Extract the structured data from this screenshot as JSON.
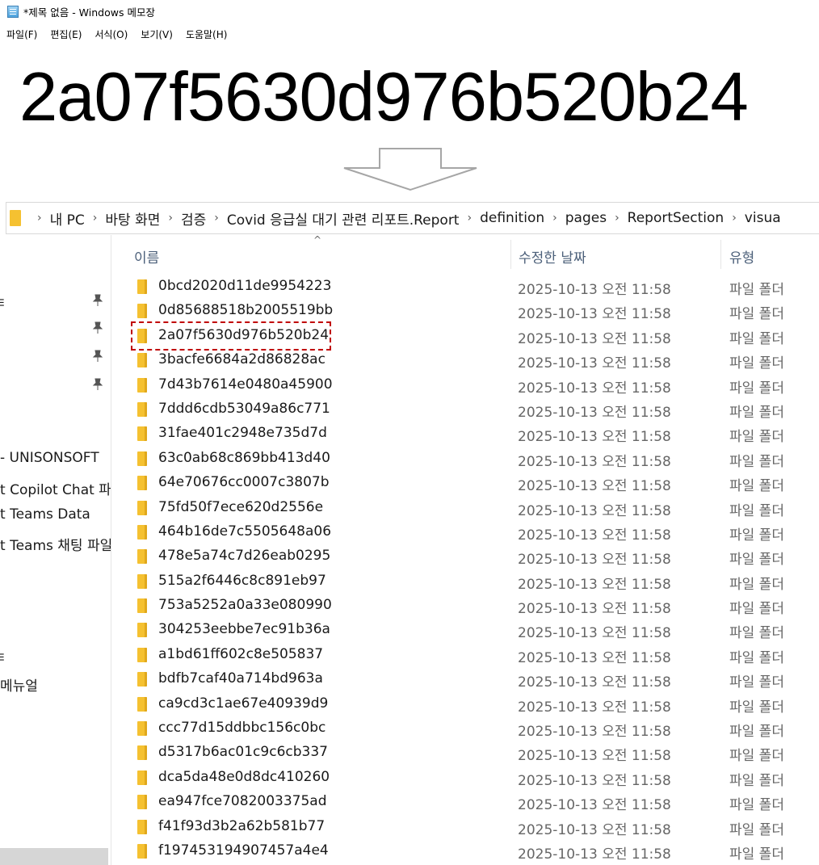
{
  "notepad": {
    "title": "*제목 없음 - Windows 메모장",
    "menu": [
      "파일(F)",
      "편집(E)",
      "서식(O)",
      "보기(V)",
      "도움말(H)"
    ],
    "content": "2a07f5630d976b520b24"
  },
  "explorer": {
    "breadcrumb": [
      "내 PC",
      "바탕 화면",
      "검증",
      "Covid 응급실 대기 관련 리포트.Report",
      "definition",
      "pages",
      "ReportSection",
      "visua"
    ],
    "nav": [
      {
        "label": "ㅌ"
      },
      {
        "label": "- UNISONSOFT"
      },
      {
        "label": "t Copilot Chat 파'"
      },
      {
        "label": "t Teams Data"
      },
      {
        "label": "t Teams 채팅 파일"
      },
      {
        "label": "ㅌ"
      },
      {
        "label": " 메뉴얼"
      }
    ],
    "columns": {
      "name": "이름",
      "date": "수정한 날짜",
      "type": "유형"
    },
    "rows": [
      {
        "name": "0bcd2020d11de9954223",
        "date": "2025-10-13 오전 11:58",
        "type": "파일 폴더"
      },
      {
        "name": "0d85688518b2005519bb",
        "date": "2025-10-13 오전 11:58",
        "type": "파일 폴더"
      },
      {
        "name": "2a07f5630d976b520b24",
        "date": "2025-10-13 오전 11:58",
        "type": "파일 폴더"
      },
      {
        "name": "3bacfe6684a2d86828ac",
        "date": "2025-10-13 오전 11:58",
        "type": "파일 폴더"
      },
      {
        "name": "7d43b7614e0480a45900",
        "date": "2025-10-13 오전 11:58",
        "type": "파일 폴더"
      },
      {
        "name": "7ddd6cdb53049a86c771",
        "date": "2025-10-13 오전 11:58",
        "type": "파일 폴더"
      },
      {
        "name": "31fae401c2948e735d7d",
        "date": "2025-10-13 오전 11:58",
        "type": "파일 폴더"
      },
      {
        "name": "63c0ab68c869bb413d40",
        "date": "2025-10-13 오전 11:58",
        "type": "파일 폴더"
      },
      {
        "name": "64e70676cc0007c3807b",
        "date": "2025-10-13 오전 11:58",
        "type": "파일 폴더"
      },
      {
        "name": "75fd50f7ece620d2556e",
        "date": "2025-10-13 오전 11:58",
        "type": "파일 폴더"
      },
      {
        "name": "464b16de7c5505648a06",
        "date": "2025-10-13 오전 11:58",
        "type": "파일 폴더"
      },
      {
        "name": "478e5a74c7d26eab0295",
        "date": "2025-10-13 오전 11:58",
        "type": "파일 폴더"
      },
      {
        "name": "515a2f6446c8c891eb97",
        "date": "2025-10-13 오전 11:58",
        "type": "파일 폴더"
      },
      {
        "name": "753a5252a0a33e080990",
        "date": "2025-10-13 오전 11:58",
        "type": "파일 폴더"
      },
      {
        "name": "304253eebbe7ec91b36a",
        "date": "2025-10-13 오전 11:58",
        "type": "파일 폴더"
      },
      {
        "name": "a1bd61ff602c8e505837",
        "date": "2025-10-13 오전 11:58",
        "type": "파일 폴더"
      },
      {
        "name": "bdfb7caf40a714bd963a",
        "date": "2025-10-13 오전 11:58",
        "type": "파일 폴더"
      },
      {
        "name": "ca9cd3c1ae67e40939d9",
        "date": "2025-10-13 오전 11:58",
        "type": "파일 폴더"
      },
      {
        "name": "ccc77d15ddbbc156c0bc",
        "date": "2025-10-13 오전 11:58",
        "type": "파일 폴더"
      },
      {
        "name": "d5317b6ac01c9c6cb337",
        "date": "2025-10-13 오전 11:58",
        "type": "파일 폴더"
      },
      {
        "name": "dca5da48e0d8dc410260",
        "date": "2025-10-13 오전 11:58",
        "type": "파일 폴더"
      },
      {
        "name": "ea947fce7082003375ad",
        "date": "2025-10-13 오전 11:58",
        "type": "파일 폴더"
      },
      {
        "name": "f41f93d3b2a62b581b77",
        "date": "2025-10-13 오전 11:58",
        "type": "파일 폴더"
      },
      {
        "name": "f197453194907457a4e4",
        "date": "2025-10-13 오전 11:58",
        "type": "파일 폴더"
      }
    ],
    "highlight_color": "#c00000"
  }
}
